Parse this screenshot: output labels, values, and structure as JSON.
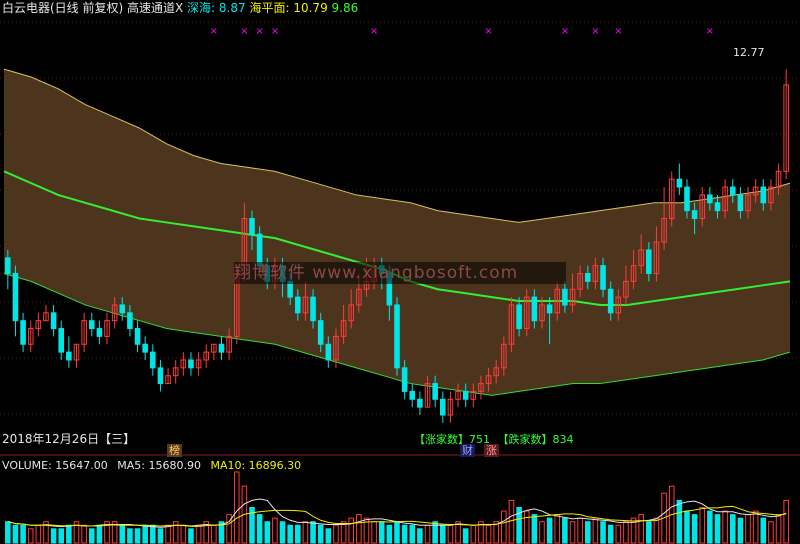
{
  "header": {
    "title": "白云电器(日线 前复权) 高速通道X",
    "shenhai_label": "深海:",
    "shenhai_value": "8.87",
    "haipingmian_label": "海平面:",
    "haipingmian_value": "10.79",
    "third_value": "9.86"
  },
  "date_label": "2018年12月26日【三】",
  "watermark": "翔博软件 www.xiangbosoft.com",
  "badges": {
    "bang": "榜",
    "cai": "财",
    "zhang": "涨"
  },
  "annotation": {
    "up_label": "【涨家数】751",
    "down_label": "【跌家数】834"
  },
  "peak_label": "12.77",
  "volume": {
    "label": "VOLUME: 15647.00",
    "ma5": "MA5: 15680.90",
    "ma10": "MA10: 16896.30"
  },
  "colors": {
    "up": "#ff3b3b",
    "down": "#00e5e5",
    "channel_fill": "#4d351d",
    "mid_line": "#33ee33",
    "upper_line": "#e6e6e6",
    "marker": "#ff00ff"
  },
  "chart_data": {
    "type": "candlestick",
    "price_range": [
      8.4,
      13.4
    ],
    "candles": [
      [
        10.4,
        10.2,
        10.5,
        10.0
      ],
      [
        10.2,
        9.6,
        10.3,
        9.4
      ],
      [
        9.6,
        9.3,
        9.7,
        9.2
      ],
      [
        9.3,
        9.5,
        9.6,
        9.2
      ],
      [
        9.5,
        9.6,
        9.7,
        9.4
      ],
      [
        9.6,
        9.7,
        9.8,
        9.6
      ],
      [
        9.7,
        9.5,
        9.8,
        9.4
      ],
      [
        9.5,
        9.2,
        9.6,
        9.1
      ],
      [
        9.2,
        9.1,
        9.4,
        9.0
      ],
      [
        9.1,
        9.3,
        9.3,
        9.0
      ],
      [
        9.3,
        9.6,
        9.7,
        9.2
      ],
      [
        9.6,
        9.5,
        9.7,
        9.4
      ],
      [
        9.5,
        9.4,
        9.6,
        9.3
      ],
      [
        9.4,
        9.6,
        9.7,
        9.3
      ],
      [
        9.6,
        9.8,
        9.9,
        9.5
      ],
      [
        9.8,
        9.7,
        9.9,
        9.6
      ],
      [
        9.7,
        9.5,
        9.8,
        9.4
      ],
      [
        9.5,
        9.3,
        9.6,
        9.2
      ],
      [
        9.3,
        9.2,
        9.4,
        9.1
      ],
      [
        9.2,
        9.0,
        9.3,
        8.9
      ],
      [
        9.0,
        8.8,
        9.1,
        8.7
      ],
      [
        8.8,
        8.9,
        9.0,
        8.8
      ],
      [
        8.9,
        9.0,
        9.1,
        8.8
      ],
      [
        9.0,
        9.1,
        9.2,
        8.9
      ],
      [
        9.1,
        9.0,
        9.2,
        8.9
      ],
      [
        9.0,
        9.1,
        9.2,
        8.9
      ],
      [
        9.1,
        9.2,
        9.3,
        9.0
      ],
      [
        9.2,
        9.3,
        9.3,
        9.1
      ],
      [
        9.3,
        9.2,
        9.4,
        9.1
      ],
      [
        9.2,
        9.4,
        9.5,
        9.1
      ],
      [
        9.4,
        10.2,
        10.3,
        9.3
      ],
      [
        10.2,
        10.9,
        11.1,
        10.1
      ],
      [
        10.9,
        10.7,
        11.0,
        10.5
      ],
      [
        10.7,
        10.3,
        10.8,
        10.2
      ],
      [
        10.3,
        10.1,
        10.4,
        10.0
      ],
      [
        10.1,
        10.3,
        10.4,
        10.0
      ],
      [
        10.3,
        10.1,
        10.4,
        9.9
      ],
      [
        10.1,
        9.9,
        10.2,
        9.8
      ],
      [
        9.9,
        9.7,
        10.0,
        9.6
      ],
      [
        9.7,
        9.9,
        10.1,
        9.6
      ],
      [
        9.9,
        9.6,
        10.0,
        9.5
      ],
      [
        9.6,
        9.3,
        9.7,
        9.2
      ],
      [
        9.3,
        9.1,
        9.4,
        9.0
      ],
      [
        9.1,
        9.4,
        9.5,
        9.0
      ],
      [
        9.4,
        9.6,
        9.8,
        9.3
      ],
      [
        9.6,
        9.8,
        10.0,
        9.5
      ],
      [
        9.8,
        10.0,
        10.2,
        9.7
      ],
      [
        10.0,
        10.1,
        10.4,
        9.9
      ],
      [
        10.1,
        10.3,
        10.4,
        10.0
      ],
      [
        10.3,
        10.2,
        10.4,
        10.0
      ],
      [
        10.2,
        9.8,
        10.3,
        9.6
      ],
      [
        9.8,
        9.0,
        9.9,
        8.9
      ],
      [
        9.0,
        8.7,
        9.1,
        8.6
      ],
      [
        8.7,
        8.6,
        8.8,
        8.5
      ],
      [
        8.6,
        8.5,
        8.7,
        8.4
      ],
      [
        8.5,
        8.8,
        8.9,
        8.5
      ],
      [
        8.8,
        8.6,
        8.9,
        8.5
      ],
      [
        8.6,
        8.4,
        8.7,
        8.3
      ],
      [
        8.4,
        8.6,
        8.7,
        8.3
      ],
      [
        8.6,
        8.7,
        8.8,
        8.5
      ],
      [
        8.7,
        8.6,
        8.8,
        8.5
      ],
      [
        8.6,
        8.7,
        8.8,
        8.5
      ],
      [
        8.7,
        8.8,
        8.9,
        8.6
      ],
      [
        8.8,
        8.9,
        9.0,
        8.7
      ],
      [
        8.9,
        9.0,
        9.1,
        8.8
      ],
      [
        9.0,
        9.3,
        9.4,
        8.9
      ],
      [
        9.3,
        9.8,
        9.9,
        9.2
      ],
      [
        9.8,
        9.5,
        9.9,
        9.4
      ],
      [
        9.5,
        9.9,
        10.0,
        9.4
      ],
      [
        9.9,
        9.6,
        10.0,
        9.5
      ],
      [
        9.6,
        9.8,
        9.9,
        9.5
      ],
      [
        9.8,
        9.7,
        9.9,
        9.3
      ],
      [
        9.7,
        10.0,
        10.1,
        9.6
      ],
      [
        10.0,
        9.8,
        10.1,
        9.7
      ],
      [
        9.8,
        10.0,
        10.2,
        9.7
      ],
      [
        10.0,
        10.2,
        10.3,
        9.9
      ],
      [
        10.2,
        10.1,
        10.3,
        10.0
      ],
      [
        10.1,
        10.3,
        10.4,
        10.0
      ],
      [
        10.3,
        10.0,
        10.4,
        9.9
      ],
      [
        10.0,
        9.7,
        10.1,
        9.6
      ],
      [
        9.7,
        9.9,
        10.0,
        9.6
      ],
      [
        9.9,
        10.1,
        10.3,
        9.8
      ],
      [
        10.1,
        10.3,
        10.5,
        10.0
      ],
      [
        10.3,
        10.5,
        10.7,
        10.2
      ],
      [
        10.5,
        10.2,
        10.6,
        10.1
      ],
      [
        10.2,
        10.6,
        10.8,
        10.1
      ],
      [
        10.6,
        10.9,
        11.3,
        10.5
      ],
      [
        10.9,
        11.4,
        11.5,
        10.8
      ],
      [
        11.4,
        11.3,
        11.6,
        11.2
      ],
      [
        11.3,
        11.0,
        11.4,
        10.9
      ],
      [
        11.0,
        10.9,
        11.1,
        10.7
      ],
      [
        10.9,
        11.2,
        11.3,
        10.8
      ],
      [
        11.2,
        11.1,
        11.3,
        11.0
      ],
      [
        11.1,
        11.0,
        11.2,
        10.9
      ],
      [
        11.0,
        11.3,
        11.4,
        10.9
      ],
      [
        11.3,
        11.2,
        11.4,
        11.1
      ],
      [
        11.2,
        11.0,
        11.3,
        10.9
      ],
      [
        11.0,
        11.2,
        11.3,
        10.9
      ],
      [
        11.2,
        11.3,
        11.4,
        11.1
      ],
      [
        11.3,
        11.1,
        11.4,
        11.0
      ],
      [
        11.1,
        11.3,
        11.4,
        11.0
      ],
      [
        11.3,
        11.5,
        11.6,
        11.2
      ],
      [
        11.5,
        12.6,
        12.8,
        11.4
      ]
    ],
    "upper_band": [
      12.8,
      12.7,
      12.55,
      12.35,
      12.2,
      12.05,
      11.85,
      11.7,
      11.6,
      11.55,
      11.5,
      11.4,
      11.3,
      11.2,
      11.15,
      11.1,
      11.0,
      10.95,
      10.9,
      10.85,
      10.9,
      10.95,
      11.0,
      11.05,
      11.1,
      11.1,
      11.15,
      11.2,
      11.25,
      11.35
    ],
    "lower_band": [
      10.2,
      10.1,
      9.95,
      9.8,
      9.7,
      9.6,
      9.5,
      9.45,
      9.4,
      9.35,
      9.3,
      9.2,
      9.1,
      9.0,
      8.9,
      8.8,
      8.75,
      8.7,
      8.65,
      8.7,
      8.75,
      8.8,
      8.8,
      8.85,
      8.9,
      8.95,
      9.0,
      9.05,
      9.1,
      9.2
    ],
    "mid_line": [
      11.5,
      11.35,
      11.2,
      11.1,
      11.0,
      10.9,
      10.85,
      10.8,
      10.75,
      10.7,
      10.65,
      10.55,
      10.45,
      10.35,
      10.25,
      10.1,
      10.0,
      9.95,
      9.9,
      9.85,
      9.85,
      9.85,
      9.8,
      9.8,
      9.85,
      9.9,
      9.95,
      10.0,
      10.05,
      10.1
    ],
    "volume_values": [
      6,
      5,
      5,
      4,
      5,
      6,
      4,
      4,
      5,
      6,
      5,
      4,
      5,
      6,
      6,
      5,
      4,
      4,
      5,
      5,
      4,
      5,
      6,
      5,
      4,
      5,
      6,
      5,
      6,
      8,
      20,
      16,
      10,
      8,
      6,
      7,
      6,
      5,
      5,
      6,
      6,
      5,
      4,
      5,
      6,
      7,
      8,
      7,
      6,
      6,
      5,
      6,
      5,
      5,
      4,
      5,
      6,
      5,
      5,
      6,
      4,
      5,
      6,
      5,
      6,
      9,
      12,
      10,
      9,
      8,
      6,
      7,
      8,
      7,
      6,
      7,
      6,
      7,
      6,
      5,
      5,
      6,
      7,
      8,
      6,
      7,
      14,
      16,
      12,
      9,
      8,
      10,
      9,
      8,
      9,
      8,
      7,
      8,
      9,
      7,
      6,
      8,
      12
    ],
    "marker_indices": [
      27,
      31,
      33,
      35,
      48,
      63,
      73,
      77,
      80,
      92
    ]
  }
}
